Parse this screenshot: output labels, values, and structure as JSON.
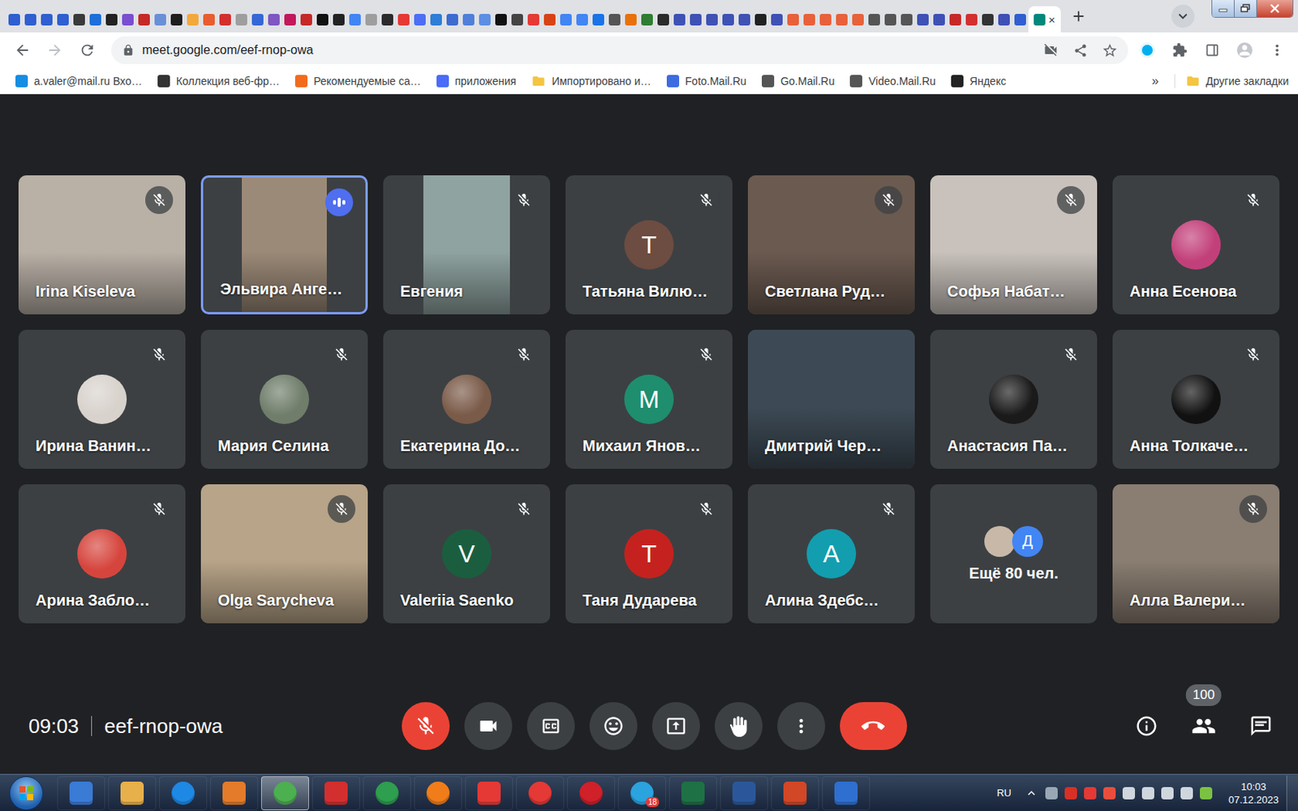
{
  "browser": {
    "tabs": [
      {
        "color": "#2f5fd0",
        "selected": false
      },
      {
        "color": "#2f5fd0",
        "selected": false
      },
      {
        "color": "#2f5fd0",
        "selected": false
      },
      {
        "color": "#2f5fd0",
        "selected": false
      },
      {
        "color": "#3a3a3a",
        "selected": false
      },
      {
        "color": "#1e6fd9",
        "selected": false
      },
      {
        "color": "#222222",
        "selected": false
      },
      {
        "color": "#7b4dd0",
        "selected": false
      },
      {
        "color": "#c62828",
        "selected": false
      },
      {
        "color": "#6a8fd8",
        "selected": false
      },
      {
        "color": "#1e1e1e",
        "selected": false
      },
      {
        "color": "#f2a93b",
        "selected": false
      },
      {
        "color": "#e85d2f",
        "selected": false
      },
      {
        "color": "#d32f2f",
        "selected": false
      },
      {
        "color": "#9e9e9e",
        "selected": false
      },
      {
        "color": "#3567d6",
        "selected": false
      },
      {
        "color": "#7e57c2",
        "selected": false
      },
      {
        "color": "#c2185b",
        "selected": false
      },
      {
        "color": "#c62828",
        "selected": false
      },
      {
        "color": "#111111",
        "selected": false
      },
      {
        "color": "#222222",
        "selected": false
      },
      {
        "color": "#4285f4",
        "selected": false
      },
      {
        "color": "#9e9e9e",
        "selected": false
      },
      {
        "color": "#2b2b2b",
        "selected": false
      },
      {
        "color": "#e53935",
        "selected": false
      },
      {
        "color": "#4c6ef5",
        "selected": false
      },
      {
        "color": "#2e7dd7",
        "selected": false
      },
      {
        "color": "#3d6ccf",
        "selected": false
      },
      {
        "color": "#4f7fd9",
        "selected": false
      },
      {
        "color": "#5c8ee3",
        "selected": false
      },
      {
        "color": "#111111",
        "selected": false
      },
      {
        "color": "#444444",
        "selected": false
      },
      {
        "color": "#e53935",
        "selected": false
      },
      {
        "color": "#d84315",
        "selected": false
      },
      {
        "color": "#4285f4",
        "selected": false
      },
      {
        "color": "#4285f4",
        "selected": false
      },
      {
        "color": "#1a73e8",
        "selected": false
      },
      {
        "color": "#555555",
        "selected": false
      },
      {
        "color": "#e8710a",
        "selected": false
      },
      {
        "color": "#2e7d32",
        "selected": false
      },
      {
        "color": "#2b2b2b",
        "selected": false
      },
      {
        "color": "#3f51b5",
        "selected": false
      },
      {
        "color": "#3f51b5",
        "selected": false
      },
      {
        "color": "#3f51b5",
        "selected": false
      },
      {
        "color": "#3f51b5",
        "selected": false
      },
      {
        "color": "#3f51b5",
        "selected": false
      },
      {
        "color": "#222222",
        "selected": false
      },
      {
        "color": "#3f51b5",
        "selected": false
      },
      {
        "color": "#e8613a",
        "selected": false
      },
      {
        "color": "#e8613a",
        "selected": false
      },
      {
        "color": "#e8613a",
        "selected": false
      },
      {
        "color": "#e8613a",
        "selected": false
      },
      {
        "color": "#e8613a",
        "selected": false
      },
      {
        "color": "#555555",
        "selected": false
      },
      {
        "color": "#555555",
        "selected": false
      },
      {
        "color": "#555555",
        "selected": false
      },
      {
        "color": "#3f51b5",
        "selected": false
      },
      {
        "color": "#3f51b5",
        "selected": false
      },
      {
        "color": "#c62828",
        "selected": false
      },
      {
        "color": "#d32f2f",
        "selected": false
      },
      {
        "color": "#333333",
        "selected": false
      },
      {
        "color": "#3f51b5",
        "selected": false
      },
      {
        "color": "#2f5fd0",
        "selected": false
      },
      {
        "color": "#00897b",
        "selected": true,
        "close": "×"
      }
    ],
    "address": "meet.google.com/eef-rnop-owa",
    "bookmarks": [
      {
        "label": "a.valer@mail.ru Вхо…",
        "kind": "site",
        "color": "#168de2"
      },
      {
        "label": "Коллекция веб-фр…",
        "kind": "site",
        "color": "#333333"
      },
      {
        "label": "Рекомендуемые са…",
        "kind": "site",
        "color": "#f26b1d"
      },
      {
        "label": "приложения",
        "kind": "site",
        "color": "#4a6cf7"
      },
      {
        "label": "Импортировано и…",
        "kind": "folder",
        "color": "#f4c542"
      },
      {
        "label": "Foto.Mail.Ru",
        "kind": "site",
        "color": "#3d6ce0"
      },
      {
        "label": "Go.Mail.Ru",
        "kind": "site",
        "color": "#555555"
      },
      {
        "label": "Video.Mail.Ru",
        "kind": "site",
        "color": "#555555"
      },
      {
        "label": "Яндекс",
        "kind": "site",
        "color": "#222222"
      }
    ],
    "bookmarks_more": "»",
    "other_bookmarks": "Другие закладки"
  },
  "meeting": {
    "tiles": [
      {
        "name": "Irina Kiseleva",
        "kind": "video",
        "muted": true,
        "speaking": false,
        "color": "#b9b0a6"
      },
      {
        "name": "Эльвира Анге…",
        "kind": "video-narrow",
        "muted": false,
        "speaking": true,
        "color": "#9c8a78"
      },
      {
        "name": "Евгения",
        "kind": "video-narrow",
        "muted": true,
        "speaking": false,
        "color": "#8fa3a0"
      },
      {
        "name": "Татьяна Вилю…",
        "kind": "letter",
        "letter": "Т",
        "muted": true,
        "speaking": false,
        "color": "#6d4c41"
      },
      {
        "name": "Светлана Руд…",
        "kind": "video",
        "muted": true,
        "speaking": false,
        "color": "#6b5a50"
      },
      {
        "name": "Софья Набат…",
        "kind": "video",
        "muted": true,
        "speaking": false,
        "color": "#c9c2bc"
      },
      {
        "name": "Анна Есенова",
        "kind": "photo",
        "muted": true,
        "speaking": false,
        "color": "#c2407a"
      },
      {
        "name": "Ирина Ванин…",
        "kind": "photo",
        "muted": true,
        "speaking": false,
        "color": "#d8d2cc"
      },
      {
        "name": "Мария Селина",
        "kind": "photo",
        "muted": true,
        "speaking": false,
        "color": "#6f7d6a"
      },
      {
        "name": "Екатерина До…",
        "kind": "photo",
        "muted": true,
        "speaking": false,
        "color": "#7a5a48"
      },
      {
        "name": "Михаил Янов…",
        "kind": "letter",
        "letter": "М",
        "muted": true,
        "speaking": false,
        "color": "#1e8e6e"
      },
      {
        "name": "Дмитрий Чер…",
        "kind": "video",
        "muted": false,
        "speaking": false,
        "color": "#3d4a55"
      },
      {
        "name": "Анастасия Па…",
        "kind": "photo",
        "muted": true,
        "speaking": false,
        "color": "#1a1a1a"
      },
      {
        "name": "Анна Толкаче…",
        "kind": "photo",
        "muted": true,
        "speaking": false,
        "color": "#111111"
      },
      {
        "name": "Арина Забло…",
        "kind": "photo",
        "muted": true,
        "speaking": false,
        "color": "#d6453d"
      },
      {
        "name": "Olga Sarycheva",
        "kind": "video",
        "muted": true,
        "speaking": false,
        "color": "#b8a488"
      },
      {
        "name": "Valeriia Saenko",
        "kind": "letter",
        "letter": "V",
        "muted": true,
        "speaking": false,
        "color": "#1b5e3f"
      },
      {
        "name": "Таня Дударева",
        "kind": "letter",
        "letter": "Т",
        "muted": true,
        "speaking": false,
        "color": "#c5221f"
      },
      {
        "name": "Алина Здебс…",
        "kind": "letter",
        "letter": "А",
        "muted": true,
        "speaking": false,
        "color": "#129eaf"
      },
      {
        "kind": "more",
        "label": "Ещё 80 чел.",
        "avatars": [
          {
            "letter": "",
            "color": "#c8b8a8"
          },
          {
            "letter": "Д",
            "color": "#4285f4"
          }
        ]
      },
      {
        "name": "Алла Валери…",
        "kind": "video",
        "muted": true,
        "speaking": false,
        "color": "#8a7e72"
      }
    ],
    "time": "09:03",
    "code": "eef-rnop-owa",
    "mic_muted": true,
    "camera_off": false,
    "participants_count": "100"
  },
  "taskbar": {
    "apps": [
      {
        "kind": "square",
        "color": "#3a7bd5",
        "selected": false
      },
      {
        "kind": "square",
        "color": "#e8b04a",
        "selected": false
      },
      {
        "kind": "circle",
        "color": "#1e88e5",
        "selected": false
      },
      {
        "kind": "square",
        "color": "#e37b2a",
        "selected": false
      },
      {
        "kind": "circle",
        "color": "#4caf50",
        "selected": true
      },
      {
        "kind": "square",
        "color": "#d32f2f",
        "selected": false
      },
      {
        "kind": "circle",
        "color": "#2e9e4f",
        "selected": false
      },
      {
        "kind": "circle",
        "color": "#f07d1a",
        "selected": false
      },
      {
        "kind": "square",
        "color": "#e53935",
        "selected": false
      },
      {
        "kind": "circle",
        "color": "#e53935",
        "selected": false
      },
      {
        "kind": "circle",
        "color": "#d0202a",
        "selected": false
      },
      {
        "kind": "circle",
        "color": "#2aa3df",
        "selected": false,
        "badge": "18"
      },
      {
        "kind": "square",
        "color": "#1e7145",
        "selected": false
      },
      {
        "kind": "square",
        "color": "#2b579a",
        "selected": false
      },
      {
        "kind": "square",
        "color": "#d24726",
        "selected": false
      },
      {
        "kind": "square",
        "color": "#2f6fd0",
        "selected": false
      }
    ],
    "language": "RU",
    "tray_icons": [
      {
        "color": "#9aa7b5"
      },
      {
        "color": "#d93025"
      },
      {
        "color": "#e53935"
      },
      {
        "color": "#e94e3d"
      },
      {
        "color": "#cfd6de"
      },
      {
        "color": "#cfd6de"
      },
      {
        "color": "#cfd6de"
      },
      {
        "color": "#cfd6de"
      },
      {
        "color": "#7cc242"
      }
    ],
    "clock_time": "10:03",
    "clock_date": "07.12.2023"
  }
}
